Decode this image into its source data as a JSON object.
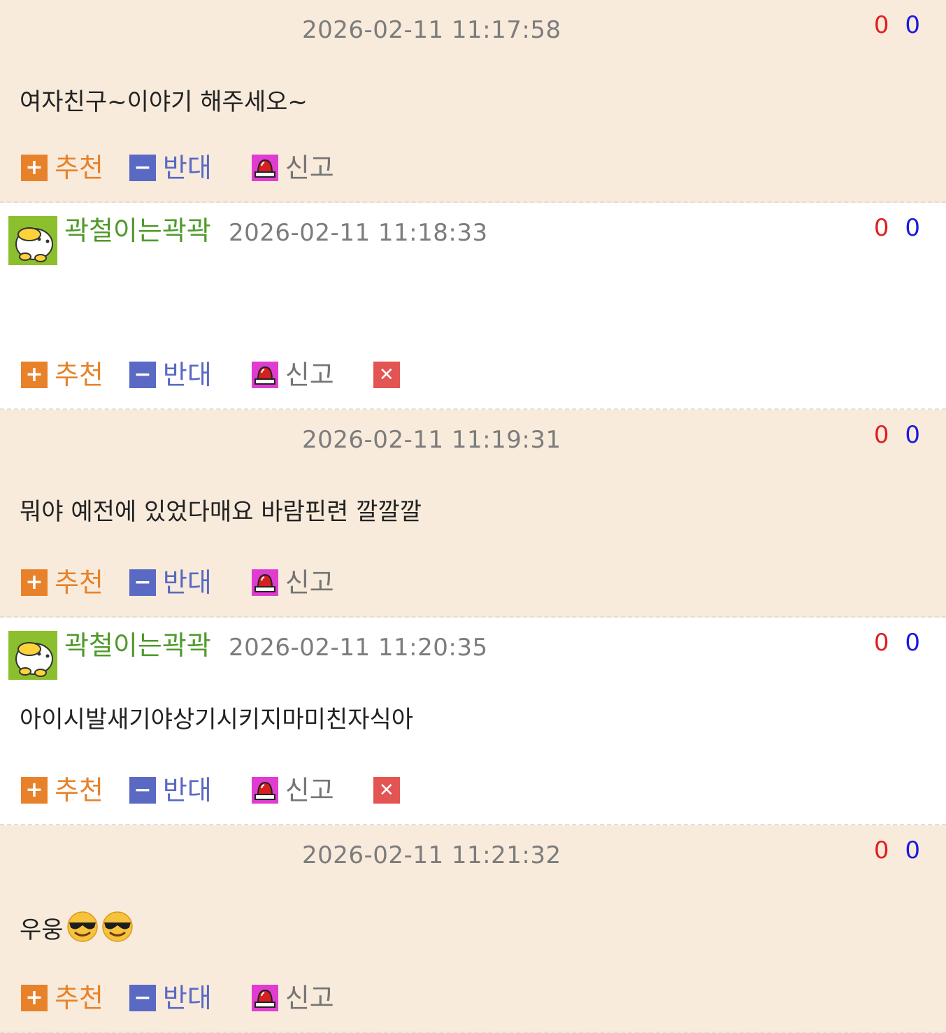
{
  "labels": {
    "recommend": "추천",
    "oppose": "반대",
    "report": "신고",
    "plus_icon": "+",
    "minus_icon": "−",
    "delete_icon": "✕"
  },
  "comments": [
    {
      "type": "anon",
      "author": "",
      "time": "2026-02-11 11:17:58",
      "up": "0",
      "down": "0",
      "text": "여자친구~이야기 해주세오~",
      "emoji_count": 0,
      "deletable": false
    },
    {
      "type": "member",
      "author": "곽철이는곽곽",
      "time": "2026-02-11 11:18:33",
      "up": "0",
      "down": "0",
      "text": "",
      "emoji_count": 0,
      "deletable": true
    },
    {
      "type": "anon",
      "author": "",
      "time": "2026-02-11 11:19:31",
      "up": "0",
      "down": "0",
      "text": "뭐야 예전에 있었다매요 바람핀련 깔깔깔",
      "emoji_count": 0,
      "deletable": false
    },
    {
      "type": "member",
      "author": "곽철이는곽곽",
      "time": "2026-02-11 11:20:35",
      "up": "0",
      "down": "0",
      "text": "아이시발새기야상기시키지마미친자식아",
      "emoji_count": 0,
      "deletable": true
    },
    {
      "type": "anon",
      "author": "",
      "time": "2026-02-11 11:21:32",
      "up": "0",
      "down": "0",
      "text": "우웅",
      "emoji_count": 2,
      "deletable": false
    }
  ],
  "colors": {
    "anon_bg": "#f8ebdc",
    "member_bg": "#ffffff",
    "author_green": "#4f9a2a",
    "vote_up": "#e02020",
    "vote_down": "#1a1ae0",
    "recommend": "#e8822a",
    "oppose": "#5a69c4",
    "report_icon": "#e03cd0",
    "delete": "#e25552"
  },
  "icons": {
    "avatar": "duck-avatar-icon",
    "report": "siren-icon",
    "emoji": "sunglasses-emoji-icon"
  }
}
